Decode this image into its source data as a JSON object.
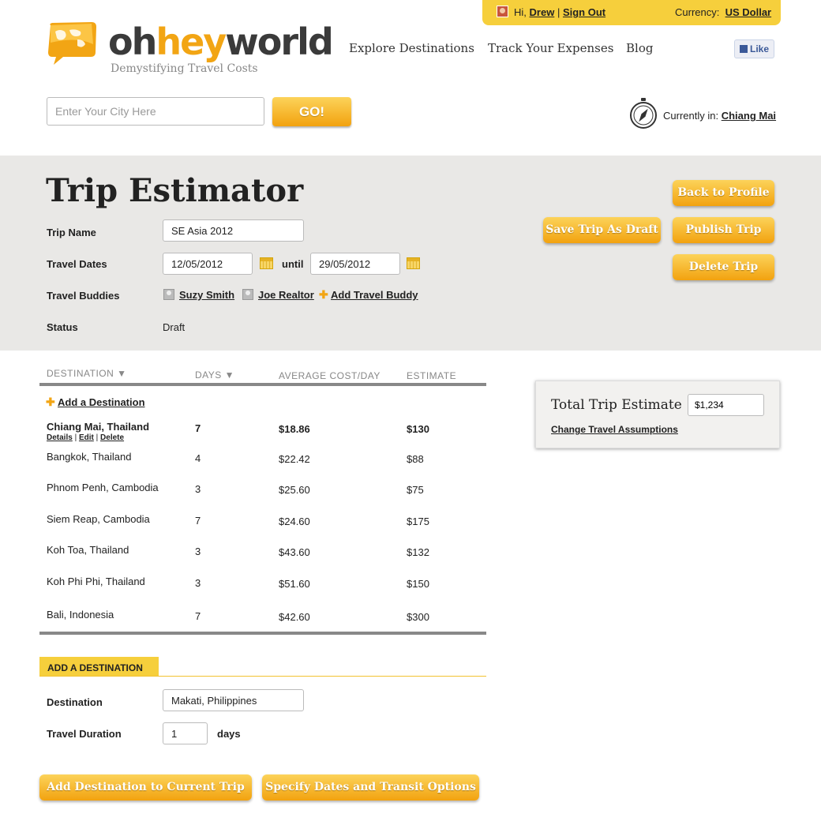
{
  "userbar": {
    "greeting": "Hi,",
    "user": "Drew",
    "sep": "|",
    "signout": "Sign Out",
    "currency_label": "Currency:",
    "currency": "US Dollar"
  },
  "logo": {
    "part1": "oh",
    "part2": "hey",
    "part3": "world",
    "tagline": "Demystifying Travel Costs"
  },
  "nav": {
    "explore": "Explore Destinations",
    "expenses": "Track Your Expenses",
    "blog": "Blog",
    "like": "Like"
  },
  "search": {
    "placeholder": "Enter Your City Here",
    "go": "GO!"
  },
  "location": {
    "label": "Currently in:",
    "city": "Chiang Mai"
  },
  "trip": {
    "title": "Trip Estimator",
    "name_label": "Trip Name",
    "name": "SE Asia 2012",
    "dates_label": "Travel Dates",
    "start": "12/05/2012",
    "until": "until",
    "end": "29/05/2012",
    "buddies_label": "Travel Buddies",
    "buddy1": "Suzy Smith",
    "buddy2": "Joe Realtor",
    "add_buddy": "Add Travel Buddy",
    "status_label": "Status",
    "status": "Draft"
  },
  "actions": {
    "back": "Back to Profile",
    "save": "Save Trip As Draft",
    "publish": "Publish Trip",
    "delete": "Delete Trip"
  },
  "table": {
    "headers": {
      "destination": "DESTINATION ▼",
      "days": "DAYS ▼",
      "avg": "AVERAGE COST/DAY",
      "estimate": "ESTIMATE"
    },
    "add_link": "Add a Destination",
    "row_actions": {
      "details": "Details",
      "edit": "Edit",
      "delete": "Delete",
      "sep": "|"
    },
    "rows": [
      {
        "destination": "Chiang Mai, Thailand",
        "days": "7",
        "avg": "$18.86",
        "estimate": "$130"
      },
      {
        "destination": "Bangkok, Thailand",
        "days": "4",
        "avg": "$22.42",
        "estimate": "$88"
      },
      {
        "destination": "Phnom Penh, Cambodia",
        "days": "3",
        "avg": "$25.60",
        "estimate": "$75"
      },
      {
        "destination": "Siem Reap, Cambodia",
        "days": "7",
        "avg": "$24.60",
        "estimate": "$175"
      },
      {
        "destination": "Koh Toa, Thailand",
        "days": "3",
        "avg": "$43.60",
        "estimate": "$132"
      },
      {
        "destination": "Koh Phi Phi, Thailand",
        "days": "3",
        "avg": "$51.60",
        "estimate": "$150"
      },
      {
        "destination": "Bali, Indonesia",
        "days": "7",
        "avg": "$42.60",
        "estimate": "$300"
      }
    ]
  },
  "summary": {
    "label": "Total Trip Estimate",
    "value": "$1,234",
    "change": "Change Travel Assumptions"
  },
  "add_destination": {
    "section_title": "ADD A DESTINATION",
    "dest_label": "Destination",
    "dest_value": "Makati, Philippines",
    "duration_label": "Travel Duration",
    "duration_value": "1",
    "days": "days",
    "add_btn": "Add Destination to Current Trip",
    "specify_btn": "Specify Dates and Transit Options"
  },
  "colors": {
    "accent": "#f2a514",
    "button_top": "#fcd35a",
    "button_bottom": "#f2a20f",
    "userbar": "#f6cf3c",
    "band": "#e9e8e6"
  }
}
